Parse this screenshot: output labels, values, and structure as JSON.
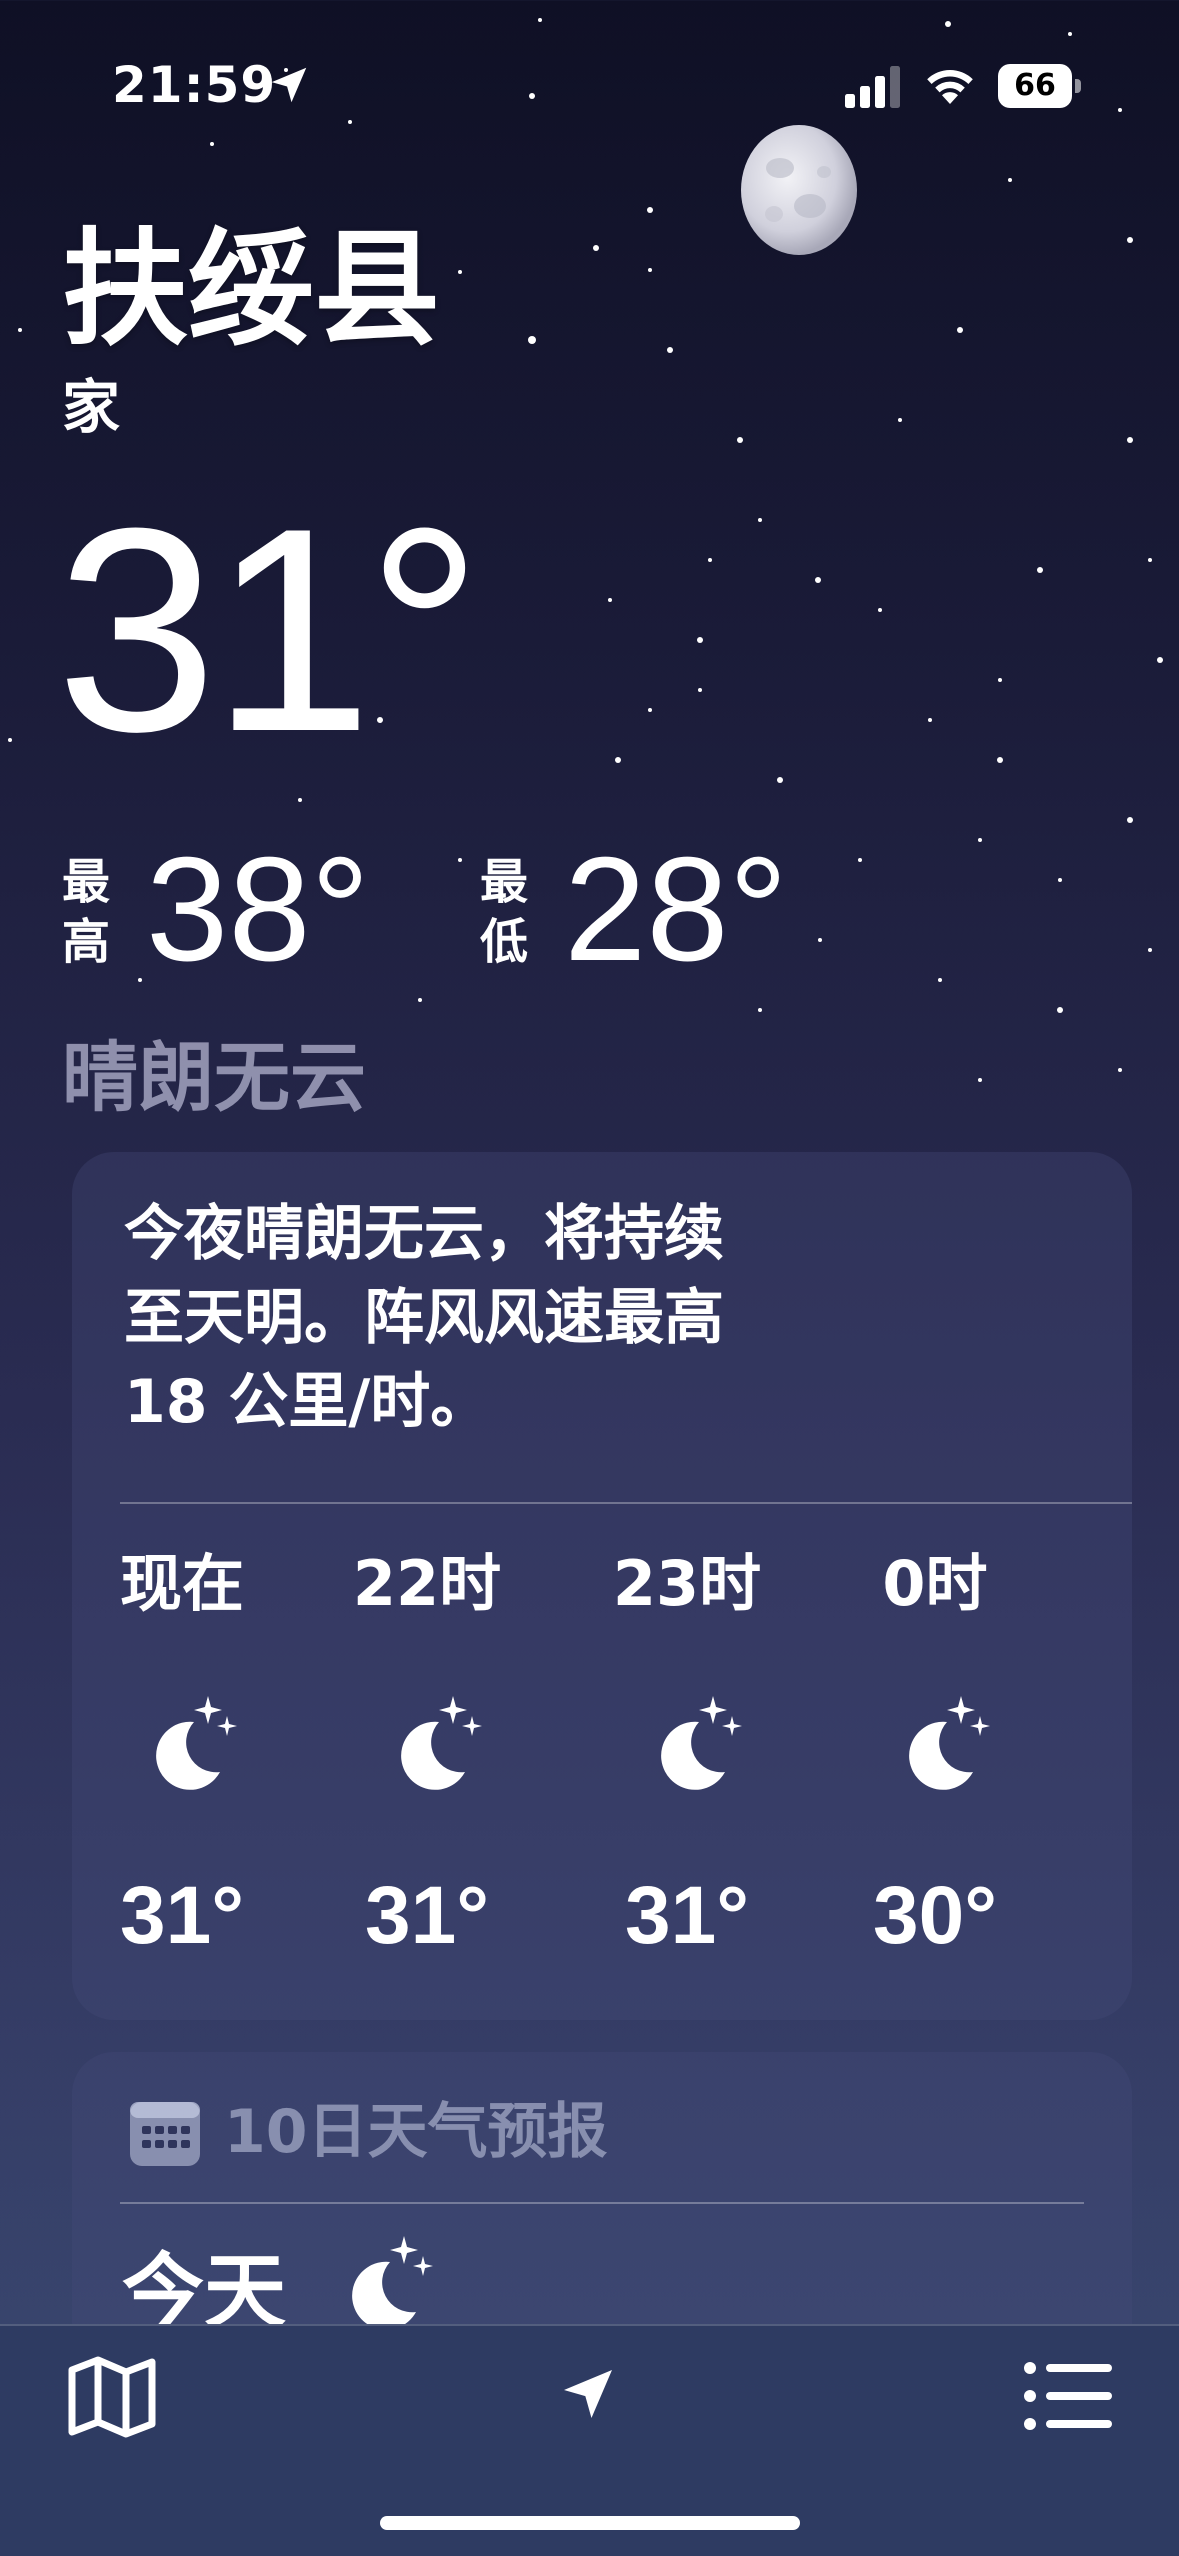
{
  "status_bar": {
    "time": "21:59",
    "battery": "66",
    "icons": [
      "location-arrow-icon",
      "cellular-signal-icon",
      "wifi-icon",
      "battery-icon"
    ]
  },
  "location": {
    "city": "扶绥县",
    "subtitle": "家"
  },
  "current": {
    "temperature": "31°",
    "high_label_1": "最",
    "high_label_2": "高",
    "high_value": "38°",
    "low_label_1": "最",
    "low_label_2": "低",
    "low_value": "28°",
    "condition": "晴朗无云"
  },
  "hourly_card": {
    "description_lines": [
      "今夜晴朗无云，将持续",
      "至天明。阵风风速最高",
      "18 公里/时。"
    ],
    "hours": [
      {
        "label": "现在",
        "icon": "moon-stars-icon",
        "temp": "31°"
      },
      {
        "label": "22时",
        "icon": "moon-stars-icon",
        "temp": "31°"
      },
      {
        "label": "23时",
        "icon": "moon-stars-icon",
        "temp": "31°"
      },
      {
        "label": "0时",
        "icon": "moon-stars-icon",
        "temp": "30°"
      }
    ]
  },
  "forecast_card": {
    "title": "10日天气预报",
    "today_label": "今天",
    "today_icon": "moon-stars-icon"
  },
  "bottom_bar": {
    "icons": [
      "map-icon",
      "location-arrow-icon",
      "list-icon"
    ]
  },
  "colors": {
    "background_top": "#0f1025",
    "background_bottom": "#3a4a72",
    "card": "rgba(70,75,120,0.35)",
    "bottom_bar": "#2e3b62"
  }
}
